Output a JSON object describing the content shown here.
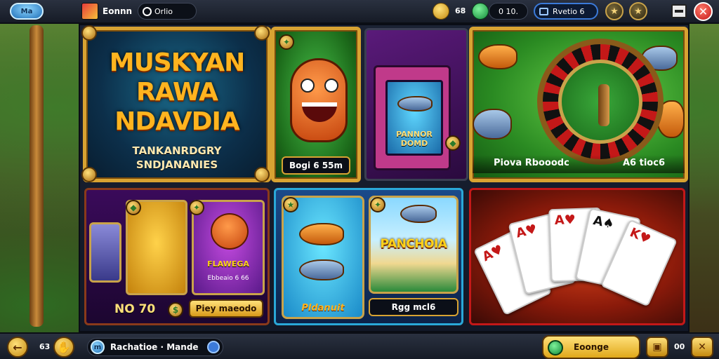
{
  "header": {
    "logo_text": "Ma",
    "player_name": "Eonnn",
    "search_text": "Orlio",
    "coins_value": "68",
    "gems_value": "0 10.",
    "bonus_label": "Rvetio 6",
    "settings_icon": "star-icon",
    "profile_icon": "star-icon",
    "close_symbol": "✕"
  },
  "tiles": {
    "title_tile": {
      "title": "MUSKYAN RAWA NDAVDIA",
      "subtitle": "TANKANRDGRY SNDJANANIES"
    },
    "monster_tile": {
      "label": "Bogi 6 55m"
    },
    "machine_tile": {
      "screen_text": "PANNOR DOMD"
    },
    "roulette_tile": {
      "caption_left": "Piova Rbooodc",
      "caption_right": "A6 tioc6"
    },
    "slots_tile": {
      "value": "NO 70",
      "button_label": "Piey maeodo",
      "badge_text": "FLAWEGA",
      "small_text": "Ebbeaio 6 66"
    },
    "fish_tile": {
      "left_label": "Pldanuit",
      "right_title": "PANCHOIA",
      "button_label": "Rgg mcl6"
    },
    "cards_tile": {
      "cards": [
        {
          "rank": "A",
          "suit": "♥",
          "color": "red"
        },
        {
          "rank": "A",
          "suit": "♥",
          "color": "red"
        },
        {
          "rank": "A",
          "suit": "♥",
          "color": "red"
        },
        {
          "rank": "A",
          "suit": "♠",
          "color": "black"
        },
        {
          "rank": "K",
          "suit": "♥",
          "color": "red"
        }
      ]
    }
  },
  "footer": {
    "back_symbol": "←",
    "level_value": "63",
    "mode_icon_text": "m",
    "mode_label": "Rachatioe · Mande",
    "play_button_label": "Eoonge",
    "count_value": "00",
    "close_symbol": "✕"
  },
  "colors": {
    "gold": "#d8a332",
    "accent_blue": "#3b7ad9",
    "danger": "#c41818"
  }
}
